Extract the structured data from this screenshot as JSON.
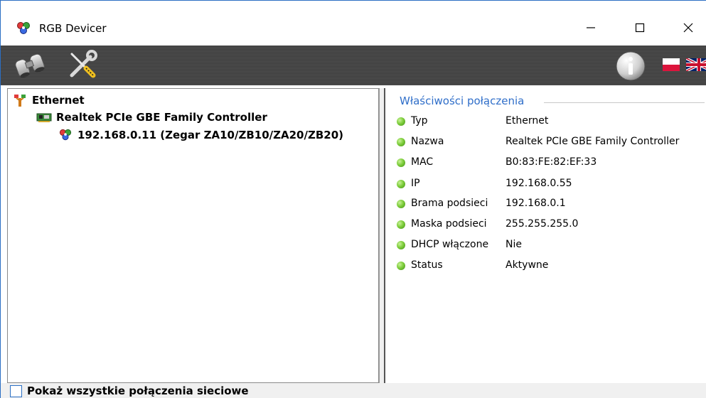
{
  "window": {
    "title": "RGB Devicer",
    "controls": {
      "minimize": "—",
      "maximize": "☐",
      "close": "✕"
    }
  },
  "toolbar": {
    "left_icons": [
      "binoculars-icon",
      "tools-icon"
    ],
    "right_icons": [
      "info-icon",
      "flag-pl-icon",
      "flag-uk-icon"
    ]
  },
  "tree": {
    "root": {
      "label": "Ethernet",
      "icon": "network-cable-icon"
    },
    "adapter": {
      "label": "Realtek PCIe GBE Family Controller",
      "icon": "network-card-icon"
    },
    "device": {
      "label": "192.168.0.11 (Zegar ZA10/ZB10/ZA20/ZB20)",
      "icon": "rgb-device-icon"
    }
  },
  "properties": {
    "title": "Właściwości połączenia",
    "items": [
      {
        "name": "Typ",
        "value": "Ethernet"
      },
      {
        "name": "Nazwa",
        "value": "Realtek PCIe GBE Family Controller"
      },
      {
        "name": "MAC",
        "value": "B0:83:FE:82:EF:33"
      },
      {
        "name": "IP",
        "value": "192.168.0.55"
      },
      {
        "name": "Brama podsieci",
        "value": "192.168.0.1"
      },
      {
        "name": "Maska podsieci",
        "value": "255.255.255.0"
      },
      {
        "name": "DHCP włączone",
        "value": "Nie"
      },
      {
        "name": "Status",
        "value": "Aktywne"
      }
    ],
    "status_color": "#6cc02a"
  },
  "footer": {
    "show_all_label": "Pokaż wszystkie połączenia sieciowe",
    "show_all_checked": false
  },
  "colors": {
    "accent": "#2f6ec9",
    "toolbar": "#444444"
  }
}
